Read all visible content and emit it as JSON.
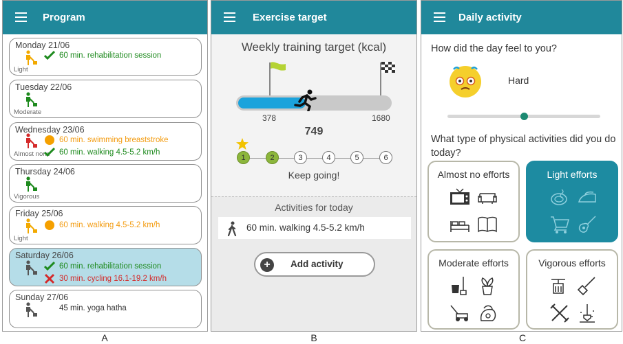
{
  "panel_a": {
    "title": "Program",
    "caption": "A",
    "days": [
      {
        "date": "Monday 21/06",
        "level": "Light",
        "activities": [
          {
            "status": "done",
            "text": "60 min. rehabilitation session"
          }
        ]
      },
      {
        "date": "Tuesday 22/06",
        "level": "Moderate",
        "activities": []
      },
      {
        "date": "Wednesday 23/06",
        "level": "Almost none",
        "activities": [
          {
            "status": "partial",
            "text": "60 min. swimming breaststroke"
          },
          {
            "status": "done",
            "text": "60 min. walking 4.5-5.2 km/h"
          }
        ]
      },
      {
        "date": "Thursday 24/06",
        "level": "Vigorous",
        "activities": []
      },
      {
        "date": "Friday 25/06",
        "level": "Light",
        "activities": [
          {
            "status": "partial",
            "text": "60 min. walking 4.5-5.2 km/h"
          }
        ]
      },
      {
        "date": "Saturday 26/06",
        "level": "",
        "activities": [
          {
            "status": "done",
            "text": "60 min. rehabilitation session"
          },
          {
            "status": "missed",
            "text": "30 min. cycling 16.1-19.2 km/h"
          }
        ]
      },
      {
        "date": "Sunday 27/06",
        "level": "",
        "activities": [
          {
            "status": "planned",
            "text": "45 min. yoga hatha"
          }
        ]
      }
    ]
  },
  "panel_b": {
    "title": "Exercise target",
    "caption": "B",
    "weekly_title": "Weekly training target (kcal)",
    "min_target": "378",
    "max_target": "1680",
    "current_value": "749",
    "progress_fraction": 0.446,
    "steps": [
      "1",
      "2",
      "3",
      "4",
      "5",
      "6"
    ],
    "steps_completed": 2,
    "encouragement": "Keep going!",
    "activities_header": "Activities for today",
    "today_activity": "60 min. walking 4.5-5.2 km/h",
    "add_button": "Add activity"
  },
  "panel_c": {
    "title": "Daily activity",
    "caption": "C",
    "question_feel": "How did the day feel to you?",
    "feeling": "Hard",
    "feeling_slider_fraction": 0.5,
    "question_type": "What type of physical activities did you do today?",
    "categories": [
      {
        "label": "Almost no efforts",
        "selected": false,
        "icons": [
          "tv-icon",
          "sofa-icon",
          "bed-icon",
          "book-icon"
        ]
      },
      {
        "label": "Light efforts",
        "selected": true,
        "icons": [
          "cooking-icon",
          "ironing-icon",
          "shopping-cart-icon",
          "guitar-icon"
        ]
      },
      {
        "label": "Moderate efforts",
        "selected": false,
        "icons": [
          "mop-bucket-icon",
          "plant-icon",
          "lawn-mower-icon",
          "vacuum-icon"
        ]
      },
      {
        "label": "Vigorous efforts",
        "selected": false,
        "icons": [
          "heavy-cleaning-icon",
          "shovel-icon",
          "tools-icon",
          "digging-icon"
        ]
      }
    ]
  },
  "colors": {
    "header": "#20889b",
    "done": "#1e8a1e",
    "partial": "#f39c12",
    "missed": "#d42a2a",
    "progress": "#1ba3dc",
    "step_done": "#8cb63c",
    "selected_card": "#1d8ba1"
  }
}
